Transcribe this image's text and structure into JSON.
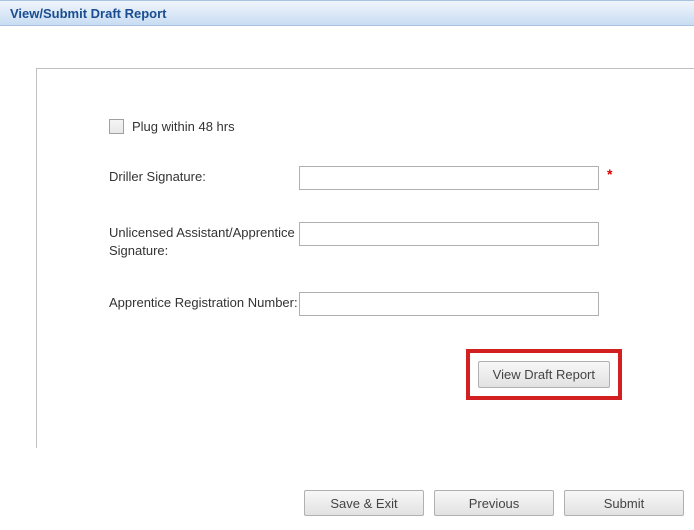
{
  "header": {
    "title": "View/Submit Draft Report"
  },
  "form": {
    "plug_checkbox_label": "Plug within 48 hrs",
    "plug_checked": false,
    "driller_signature_label": "Driller Signature:",
    "driller_signature_value": "",
    "assistant_signature_label": "Unlicensed Assistant/Apprentice Signature:",
    "assistant_signature_value": "",
    "apprentice_reg_label": "Apprentice Registration Number:",
    "apprentice_reg_value": "",
    "required_mark": "*"
  },
  "buttons": {
    "view_draft": "View Draft Report",
    "save_exit": "Save & Exit",
    "previous": "Previous",
    "submit": "Submit"
  }
}
